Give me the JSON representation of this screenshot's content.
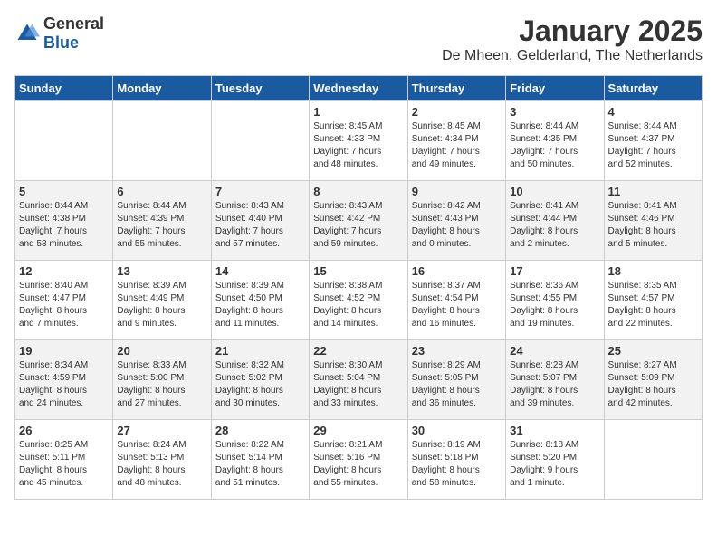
{
  "logo": {
    "general": "General",
    "blue": "Blue"
  },
  "title": "January 2025",
  "subtitle": "De Mheen, Gelderland, The Netherlands",
  "days_of_week": [
    "Sunday",
    "Monday",
    "Tuesday",
    "Wednesday",
    "Thursday",
    "Friday",
    "Saturday"
  ],
  "weeks": [
    [
      {
        "day": "",
        "info": ""
      },
      {
        "day": "",
        "info": ""
      },
      {
        "day": "",
        "info": ""
      },
      {
        "day": "1",
        "info": "Sunrise: 8:45 AM\nSunset: 4:33 PM\nDaylight: 7 hours\nand 48 minutes."
      },
      {
        "day": "2",
        "info": "Sunrise: 8:45 AM\nSunset: 4:34 PM\nDaylight: 7 hours\nand 49 minutes."
      },
      {
        "day": "3",
        "info": "Sunrise: 8:44 AM\nSunset: 4:35 PM\nDaylight: 7 hours\nand 50 minutes."
      },
      {
        "day": "4",
        "info": "Sunrise: 8:44 AM\nSunset: 4:37 PM\nDaylight: 7 hours\nand 52 minutes."
      }
    ],
    [
      {
        "day": "5",
        "info": "Sunrise: 8:44 AM\nSunset: 4:38 PM\nDaylight: 7 hours\nand 53 minutes."
      },
      {
        "day": "6",
        "info": "Sunrise: 8:44 AM\nSunset: 4:39 PM\nDaylight: 7 hours\nand 55 minutes."
      },
      {
        "day": "7",
        "info": "Sunrise: 8:43 AM\nSunset: 4:40 PM\nDaylight: 7 hours\nand 57 minutes."
      },
      {
        "day": "8",
        "info": "Sunrise: 8:43 AM\nSunset: 4:42 PM\nDaylight: 7 hours\nand 59 minutes."
      },
      {
        "day": "9",
        "info": "Sunrise: 8:42 AM\nSunset: 4:43 PM\nDaylight: 8 hours\nand 0 minutes."
      },
      {
        "day": "10",
        "info": "Sunrise: 8:41 AM\nSunset: 4:44 PM\nDaylight: 8 hours\nand 2 minutes."
      },
      {
        "day": "11",
        "info": "Sunrise: 8:41 AM\nSunset: 4:46 PM\nDaylight: 8 hours\nand 5 minutes."
      }
    ],
    [
      {
        "day": "12",
        "info": "Sunrise: 8:40 AM\nSunset: 4:47 PM\nDaylight: 8 hours\nand 7 minutes."
      },
      {
        "day": "13",
        "info": "Sunrise: 8:39 AM\nSunset: 4:49 PM\nDaylight: 8 hours\nand 9 minutes."
      },
      {
        "day": "14",
        "info": "Sunrise: 8:39 AM\nSunset: 4:50 PM\nDaylight: 8 hours\nand 11 minutes."
      },
      {
        "day": "15",
        "info": "Sunrise: 8:38 AM\nSunset: 4:52 PM\nDaylight: 8 hours\nand 14 minutes."
      },
      {
        "day": "16",
        "info": "Sunrise: 8:37 AM\nSunset: 4:54 PM\nDaylight: 8 hours\nand 16 minutes."
      },
      {
        "day": "17",
        "info": "Sunrise: 8:36 AM\nSunset: 4:55 PM\nDaylight: 8 hours\nand 19 minutes."
      },
      {
        "day": "18",
        "info": "Sunrise: 8:35 AM\nSunset: 4:57 PM\nDaylight: 8 hours\nand 22 minutes."
      }
    ],
    [
      {
        "day": "19",
        "info": "Sunrise: 8:34 AM\nSunset: 4:59 PM\nDaylight: 8 hours\nand 24 minutes."
      },
      {
        "day": "20",
        "info": "Sunrise: 8:33 AM\nSunset: 5:00 PM\nDaylight: 8 hours\nand 27 minutes."
      },
      {
        "day": "21",
        "info": "Sunrise: 8:32 AM\nSunset: 5:02 PM\nDaylight: 8 hours\nand 30 minutes."
      },
      {
        "day": "22",
        "info": "Sunrise: 8:30 AM\nSunset: 5:04 PM\nDaylight: 8 hours\nand 33 minutes."
      },
      {
        "day": "23",
        "info": "Sunrise: 8:29 AM\nSunset: 5:05 PM\nDaylight: 8 hours\nand 36 minutes."
      },
      {
        "day": "24",
        "info": "Sunrise: 8:28 AM\nSunset: 5:07 PM\nDaylight: 8 hours\nand 39 minutes."
      },
      {
        "day": "25",
        "info": "Sunrise: 8:27 AM\nSunset: 5:09 PM\nDaylight: 8 hours\nand 42 minutes."
      }
    ],
    [
      {
        "day": "26",
        "info": "Sunrise: 8:25 AM\nSunset: 5:11 PM\nDaylight: 8 hours\nand 45 minutes."
      },
      {
        "day": "27",
        "info": "Sunrise: 8:24 AM\nSunset: 5:13 PM\nDaylight: 8 hours\nand 48 minutes."
      },
      {
        "day": "28",
        "info": "Sunrise: 8:22 AM\nSunset: 5:14 PM\nDaylight: 8 hours\nand 51 minutes."
      },
      {
        "day": "29",
        "info": "Sunrise: 8:21 AM\nSunset: 5:16 PM\nDaylight: 8 hours\nand 55 minutes."
      },
      {
        "day": "30",
        "info": "Sunrise: 8:19 AM\nSunset: 5:18 PM\nDaylight: 8 hours\nand 58 minutes."
      },
      {
        "day": "31",
        "info": "Sunrise: 8:18 AM\nSunset: 5:20 PM\nDaylight: 9 hours\nand 1 minute."
      },
      {
        "day": "",
        "info": ""
      }
    ]
  ]
}
